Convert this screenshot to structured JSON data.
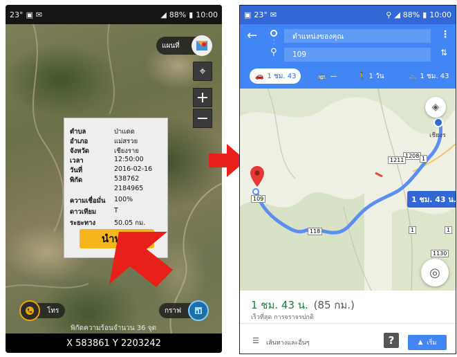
{
  "left_phone": {
    "status": {
      "temp": "23°",
      "signal_note": "₂₊",
      "battery": "88%",
      "time": "10:00"
    },
    "map_type_label": "แผนที่",
    "info": {
      "rows": [
        {
          "label": "ตำบล",
          "value": "ป่าแดด"
        },
        {
          "label": "อำเภอ",
          "value": "แม่สรวย"
        },
        {
          "label": "จังหวัด",
          "value": "เชียงราย"
        },
        {
          "label": "เวลา",
          "value": "12:50:00"
        },
        {
          "label": "วันที่",
          "value": "2016-02-16"
        },
        {
          "label": "พิกัด",
          "value": "538762"
        },
        {
          "label": "",
          "value": "2184965"
        },
        {
          "label": "ความเชื่อมั่น",
          "value": "100%"
        },
        {
          "label": "ดาวเทียม",
          "value": "T"
        },
        {
          "label": "ระยะทาง",
          "value": "50.05 กม."
        }
      ],
      "navigate_button": "นำทาง"
    },
    "call_label": "โทร",
    "graph_label": "กราฟ",
    "accuracy_text": "พิกัดความร้อนจำนวน 36 จุด",
    "coords_text": "X 583861 Y 2203242"
  },
  "right_phone": {
    "status": {
      "temp": "23°",
      "battery": "88%",
      "time": "10:00"
    },
    "origin_placeholder": "ตำแหน่งของคุณ",
    "destination_value": "109",
    "modes": [
      {
        "name": "drive",
        "label": "1 ชม. 43"
      },
      {
        "name": "transit",
        "label": "—"
      },
      {
        "name": "walk",
        "label": "1 วัน"
      },
      {
        "name": "bike",
        "label": "1 ชม. 43"
      }
    ],
    "route_time_bubble": "1 ชม. 43 น.",
    "destination_place": "เชียงร",
    "road_labels": [
      "1208",
      "1211",
      "1",
      "1",
      "1",
      "109",
      "118",
      "1130"
    ],
    "summary_time": "1 ชม. 43 น.",
    "summary_distance": "(85 กม.)",
    "summary_note": "เร็วที่สุด การจราจรปกติ",
    "steps_label": "เส้นทางและอื่นๆ",
    "start_label": "เริ่ม"
  },
  "colors": {
    "google_blue": "#4285f4",
    "status_blue": "#3367d6",
    "route_blue": "#5b8ef0",
    "nav_yellow": "#f6b51a",
    "arrow_red": "#e8201a",
    "time_green": "#188038"
  }
}
